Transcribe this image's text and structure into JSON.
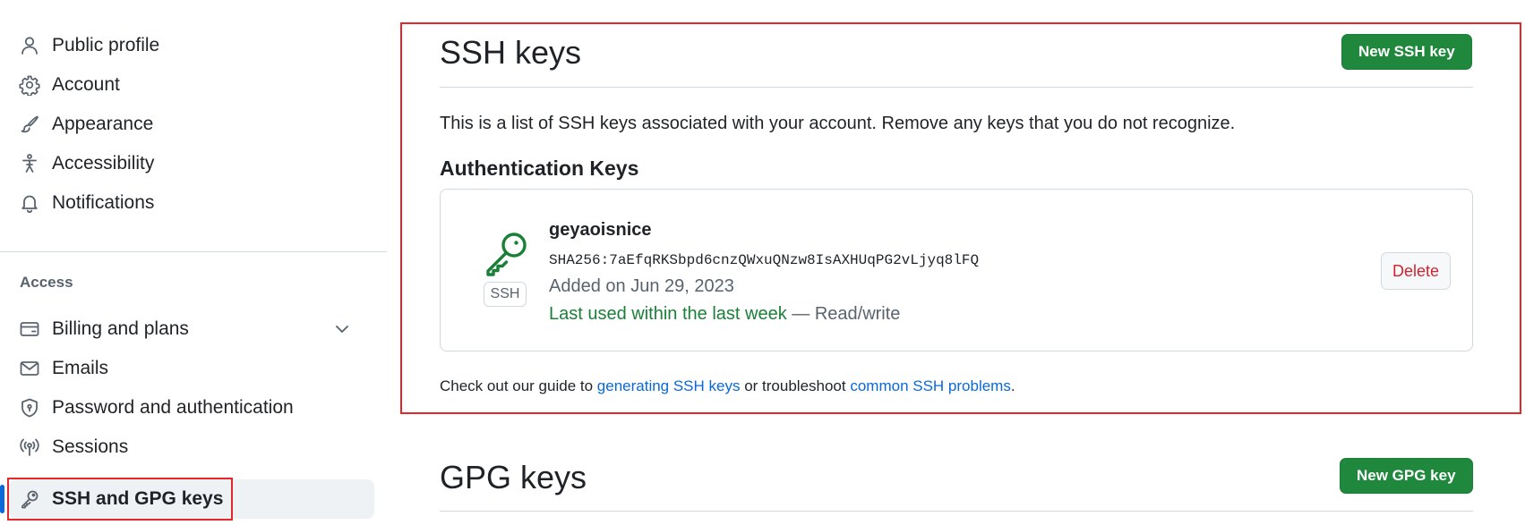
{
  "sidebar": {
    "items": [
      {
        "label": "Public profile",
        "icon": "person-icon"
      },
      {
        "label": "Account",
        "icon": "gear-icon"
      },
      {
        "label": "Appearance",
        "icon": "paintbrush-icon"
      },
      {
        "label": "Accessibility",
        "icon": "accessibility-icon"
      },
      {
        "label": "Notifications",
        "icon": "bell-icon"
      }
    ],
    "access_heading": "Access",
    "access_items": [
      {
        "label": "Billing and plans",
        "icon": "credit-card-icon",
        "expandable": true
      },
      {
        "label": "Emails",
        "icon": "mail-icon"
      },
      {
        "label": "Password and authentication",
        "icon": "shield-lock-icon"
      },
      {
        "label": "Sessions",
        "icon": "broadcast-icon"
      },
      {
        "label": "SSH and GPG keys",
        "icon": "key-icon",
        "active": true
      }
    ]
  },
  "ssh": {
    "title": "SSH keys",
    "new_button": "New SSH key",
    "description": "This is a list of SSH keys associated with your account. Remove any keys that you do not recognize.",
    "auth_heading": "Authentication Keys",
    "key": {
      "name": "geyaoisnice",
      "badge": "SSH",
      "fingerprint": "SHA256:7aEfqRKSbpd6cnzQWxuQNzw8IsAXHUqPG2vLjyq8lFQ",
      "added": "Added on Jun 29, 2023",
      "last_used": "Last used within the last week",
      "separator": " — ",
      "access": "Read/write",
      "delete_button": "Delete"
    },
    "guide": {
      "prefix": "Check out our guide to ",
      "link1": "generating SSH keys",
      "middle": " or troubleshoot ",
      "link2": "common SSH problems",
      "suffix": "."
    }
  },
  "gpg": {
    "title": "GPG keys",
    "new_button": "New GPG key"
  },
  "colors": {
    "primary_button": "#1f883d",
    "link": "#0969da",
    "danger": "#d1242f",
    "success": "#1a7f37",
    "highlight_box": "#e5262a",
    "active_indicator": "#0969da"
  }
}
